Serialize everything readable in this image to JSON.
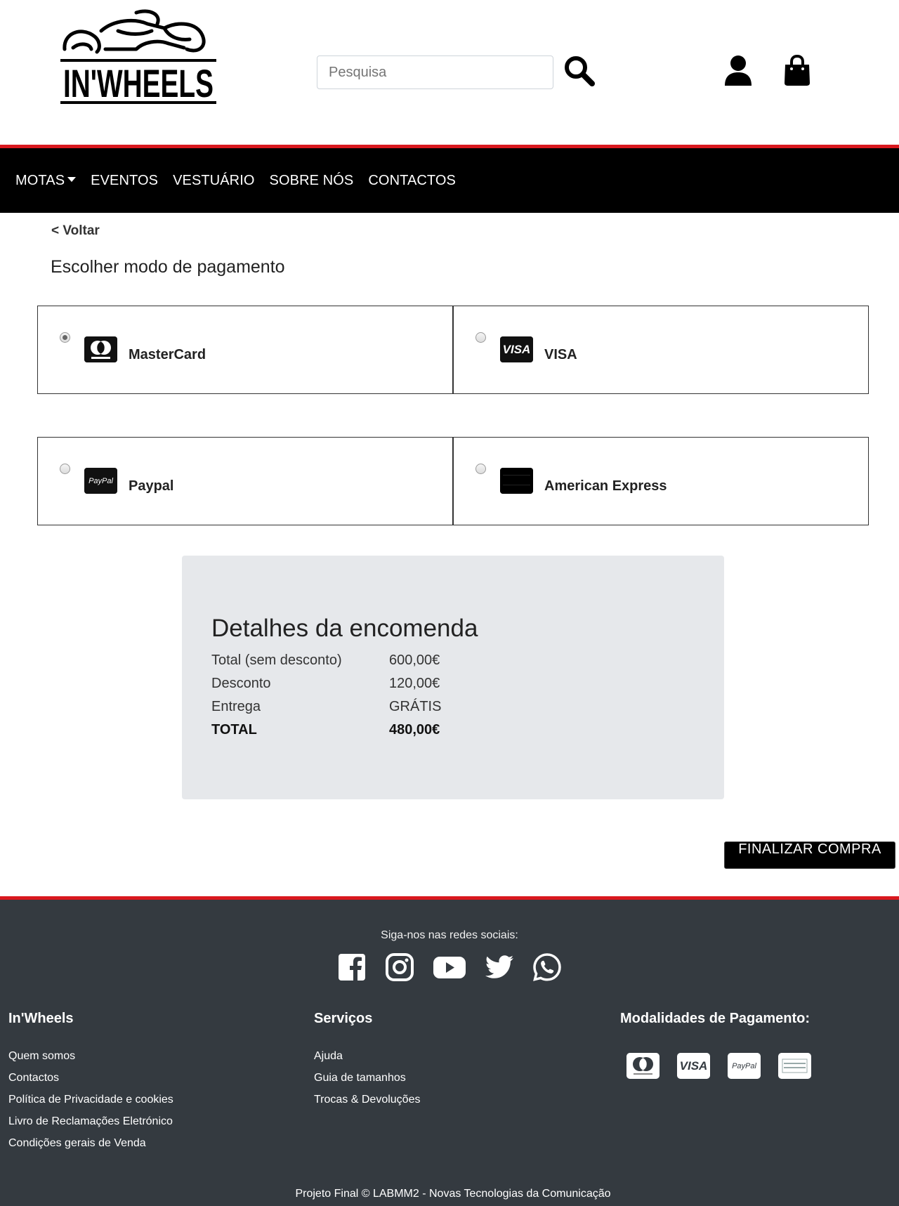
{
  "header": {
    "logo_text": "IN'WHEELS",
    "search_placeholder": "Pesquisa"
  },
  "nav": {
    "items": [
      "MOTAS",
      "EVENTOS",
      "VESTUÁRIO",
      "SOBRE NÓS",
      "CONTACTOS"
    ]
  },
  "main": {
    "back_label": "< Voltar",
    "title": "Escolher modo de pagamento",
    "payment_options": [
      {
        "label": "MasterCard",
        "selected": true
      },
      {
        "label": "VISA",
        "selected": false
      },
      {
        "label": "Paypal",
        "selected": false
      },
      {
        "label": "American Express",
        "selected": false
      }
    ]
  },
  "order": {
    "title": "Detalhes da encomenda",
    "rows": [
      {
        "label": "Total (sem desconto)",
        "value": "600,00€"
      },
      {
        "label": "Desconto",
        "value": "120,00€"
      },
      {
        "label": "Entrega",
        "value": "GRÁTIS"
      },
      {
        "label": "TOTAL",
        "value": "480,00€"
      }
    ],
    "finish_label": "FINALIZAR COMPRA"
  },
  "footer": {
    "social_title": "Siga-nos nas redes sociais:",
    "social_icons": [
      "facebook-icon",
      "instagram-icon",
      "youtube-icon",
      "twitter-icon",
      "whatsapp-icon"
    ],
    "col1": {
      "title": "In'Wheels",
      "links": [
        "Quem somos",
        "Contactos",
        "Política de Privacidade e cookies",
        "Livro de Reclamações Eletrónico",
        "Condições gerais de Venda"
      ]
    },
    "col2": {
      "title": "Serviços",
      "links": [
        "Ajuda",
        "Guia de tamanhos",
        "Trocas & Devoluções"
      ]
    },
    "col3": {
      "title": "Modalidades de Pagamento:"
    },
    "copyright": "Projeto Final © LABMM2 - Novas Tecnologias da Comunicação"
  },
  "colors": {
    "accent_red": "#d9181e",
    "nav_bg": "#000000",
    "footer_bg": "#343a40",
    "order_bg": "#e6e8eb"
  }
}
